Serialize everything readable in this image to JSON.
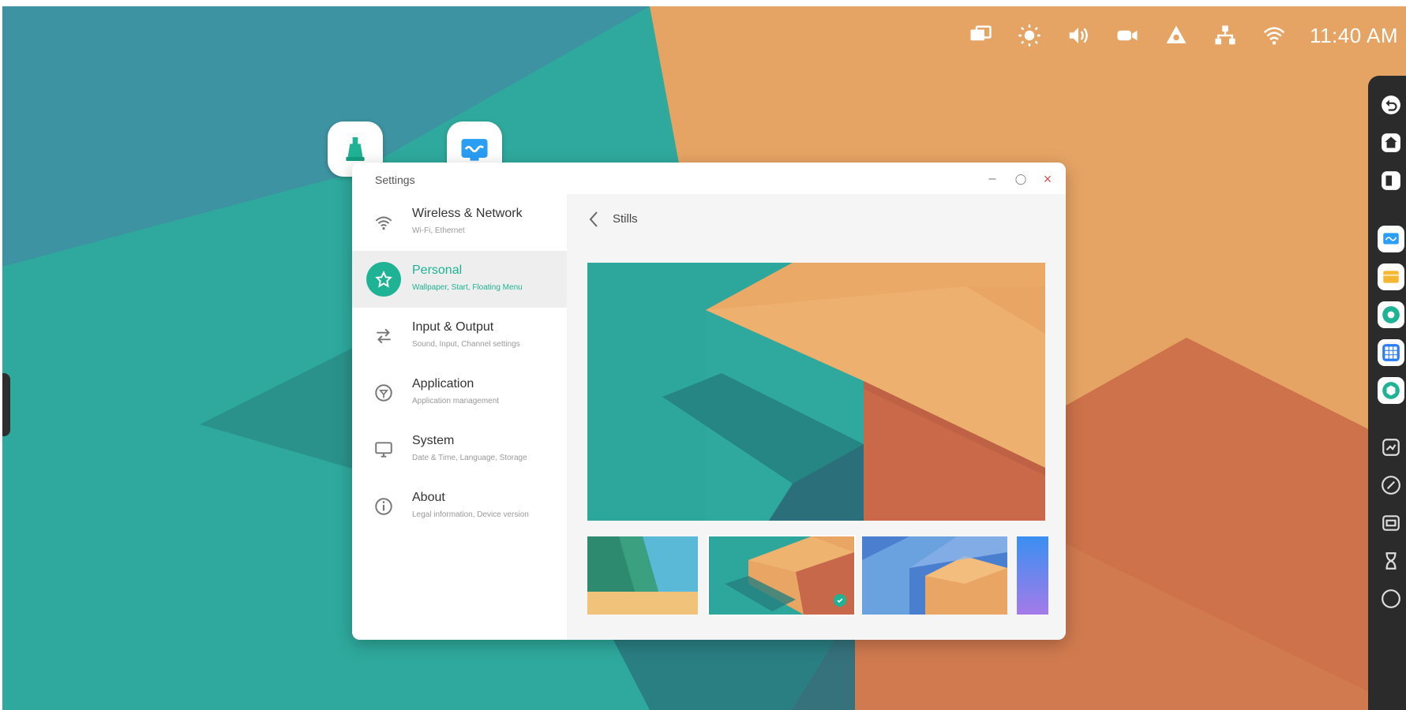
{
  "statusbar": {
    "icons": [
      "screen-share-icon",
      "brightness-icon",
      "volume-icon",
      "camera-icon",
      "hotspot-icon",
      "network-icon",
      "wifi-icon"
    ],
    "clock": "11:40 AM"
  },
  "dock": {
    "items": [
      "back-icon",
      "home-icon",
      "recent-apps-icon",
      "whiteboard-app-icon",
      "folder-app-icon",
      "browser-app-icon",
      "app-grid-icon",
      "settings-app-icon",
      "screenshot-icon",
      "annotate-icon",
      "screen-record-icon",
      "timer-icon",
      "more-icon"
    ]
  },
  "floating_apps": [
    "green-app-icon",
    "whiteboard-app-icon"
  ],
  "window": {
    "title": "Settings",
    "controls": {
      "minimize": "–",
      "maximize": "◯",
      "close": "×"
    }
  },
  "sidebar": {
    "items": [
      {
        "title": "Wireless & Network",
        "subtitle": "Wi-Fi, Ethernet",
        "icon": "wifi-icon"
      },
      {
        "title": "Personal",
        "subtitle": "Wallpaper, Start, Floating Menu",
        "icon": "star-icon",
        "active": true
      },
      {
        "title": "Input & Output",
        "subtitle": "Sound, Input, Channel settings",
        "icon": "swap-icon"
      },
      {
        "title": "Application",
        "subtitle": "Application management",
        "icon": "app-icon"
      },
      {
        "title": "System",
        "subtitle": "Date & Time, Language, Storage",
        "icon": "monitor-icon"
      },
      {
        "title": "About",
        "subtitle": "Legal information, Device version",
        "icon": "info-icon"
      }
    ]
  },
  "content": {
    "page_title": "Stills"
  },
  "colors": {
    "accent": "#1eb394",
    "teal": "#2aa89a",
    "orange": "#e9a564",
    "dark": "#2b2b2b"
  }
}
